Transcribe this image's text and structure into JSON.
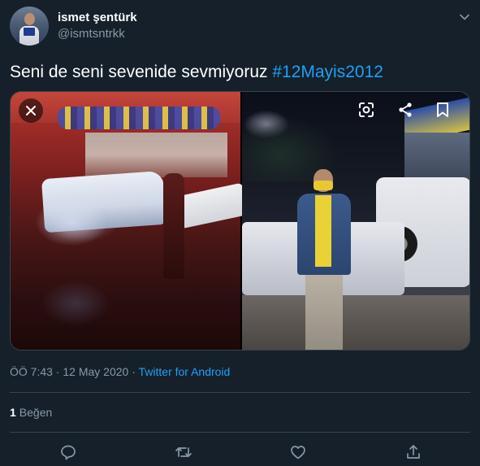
{
  "author": {
    "display_name": "ismet şentürk",
    "handle": "@ismtsntrkk"
  },
  "tweet": {
    "text": "Seni de seni sevenide sevmiyoruz ",
    "hashtag": "#12Mayis2012"
  },
  "meta": {
    "timestamp": "ÖÖ 7:43 · 12 May 2020 · ",
    "source": "Twitter for Android"
  },
  "stats": {
    "like_count": "1",
    "like_label": "Beğen"
  },
  "icons": {
    "caret": "chevron-down-icon",
    "close": "close-icon",
    "lens": "google-lens-icon",
    "share": "share-icon",
    "bookmark": "bookmark-icon",
    "reply": "reply-icon",
    "retweet": "retweet-icon",
    "like": "like-icon",
    "share_tweet": "share-tweet-icon"
  },
  "colors": {
    "background": "#15202b",
    "accent": "#1da1f2",
    "secondary_text": "#8899a6",
    "border": "#38444d"
  }
}
